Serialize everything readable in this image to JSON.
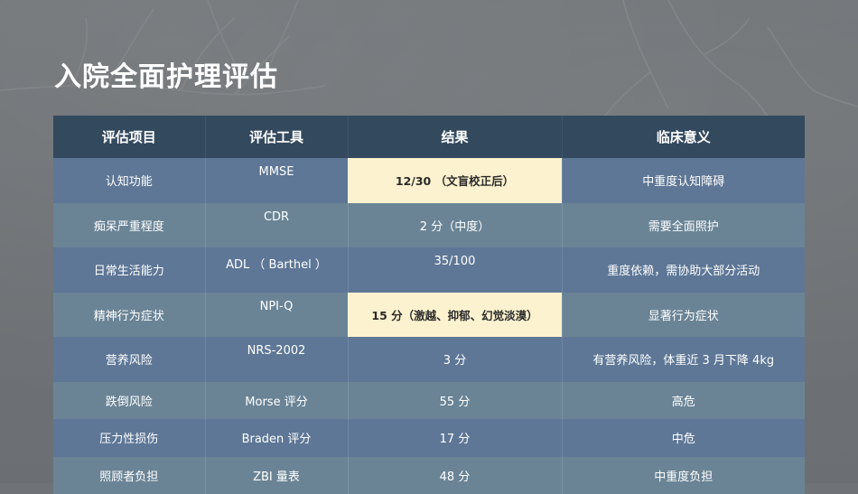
{
  "title": "入院全面护理评估",
  "table": {
    "headers": [
      "评估项目",
      "评估工具",
      "结果",
      "临床意义"
    ],
    "rows": [
      {
        "item": "认知功能",
        "tool": "MMSE",
        "result": "12/30 （文盲校正后）",
        "meaning": "中重度认知障碍",
        "highlight": true
      },
      {
        "item": "痴呆严重程度",
        "tool": "CDR",
        "result": "2 分（中度）",
        "meaning": "需要全面照护",
        "highlight": false
      },
      {
        "item": "日常生活能力",
        "tool": "ADL （ Barthel ）",
        "result": "35/100",
        "meaning": "重度依赖，需协助大部分活动",
        "highlight": false
      },
      {
        "item": "精神行为症状",
        "tool": "NPI-Q",
        "result": "15 分（激越、抑郁、幻觉淡漠）",
        "meaning": "显著行为症状",
        "highlight": true
      },
      {
        "item": "营养风险",
        "tool": "NRS-2002",
        "result": "3 分",
        "meaning": "有营养风险，体重近 3 月下降 4kg",
        "highlight": false
      },
      {
        "item": "跌倒风险",
        "tool": "Morse 评分",
        "result": "55 分",
        "meaning": "高危",
        "highlight": false
      },
      {
        "item": "压力性损伤",
        "tool": "Braden 评分",
        "result": "17 分",
        "meaning": "中危",
        "highlight": false
      },
      {
        "item": "照顾者负担",
        "tool": "ZBI 量表",
        "result": "48 分",
        "meaning": "中重度负担",
        "highlight": false
      }
    ]
  }
}
